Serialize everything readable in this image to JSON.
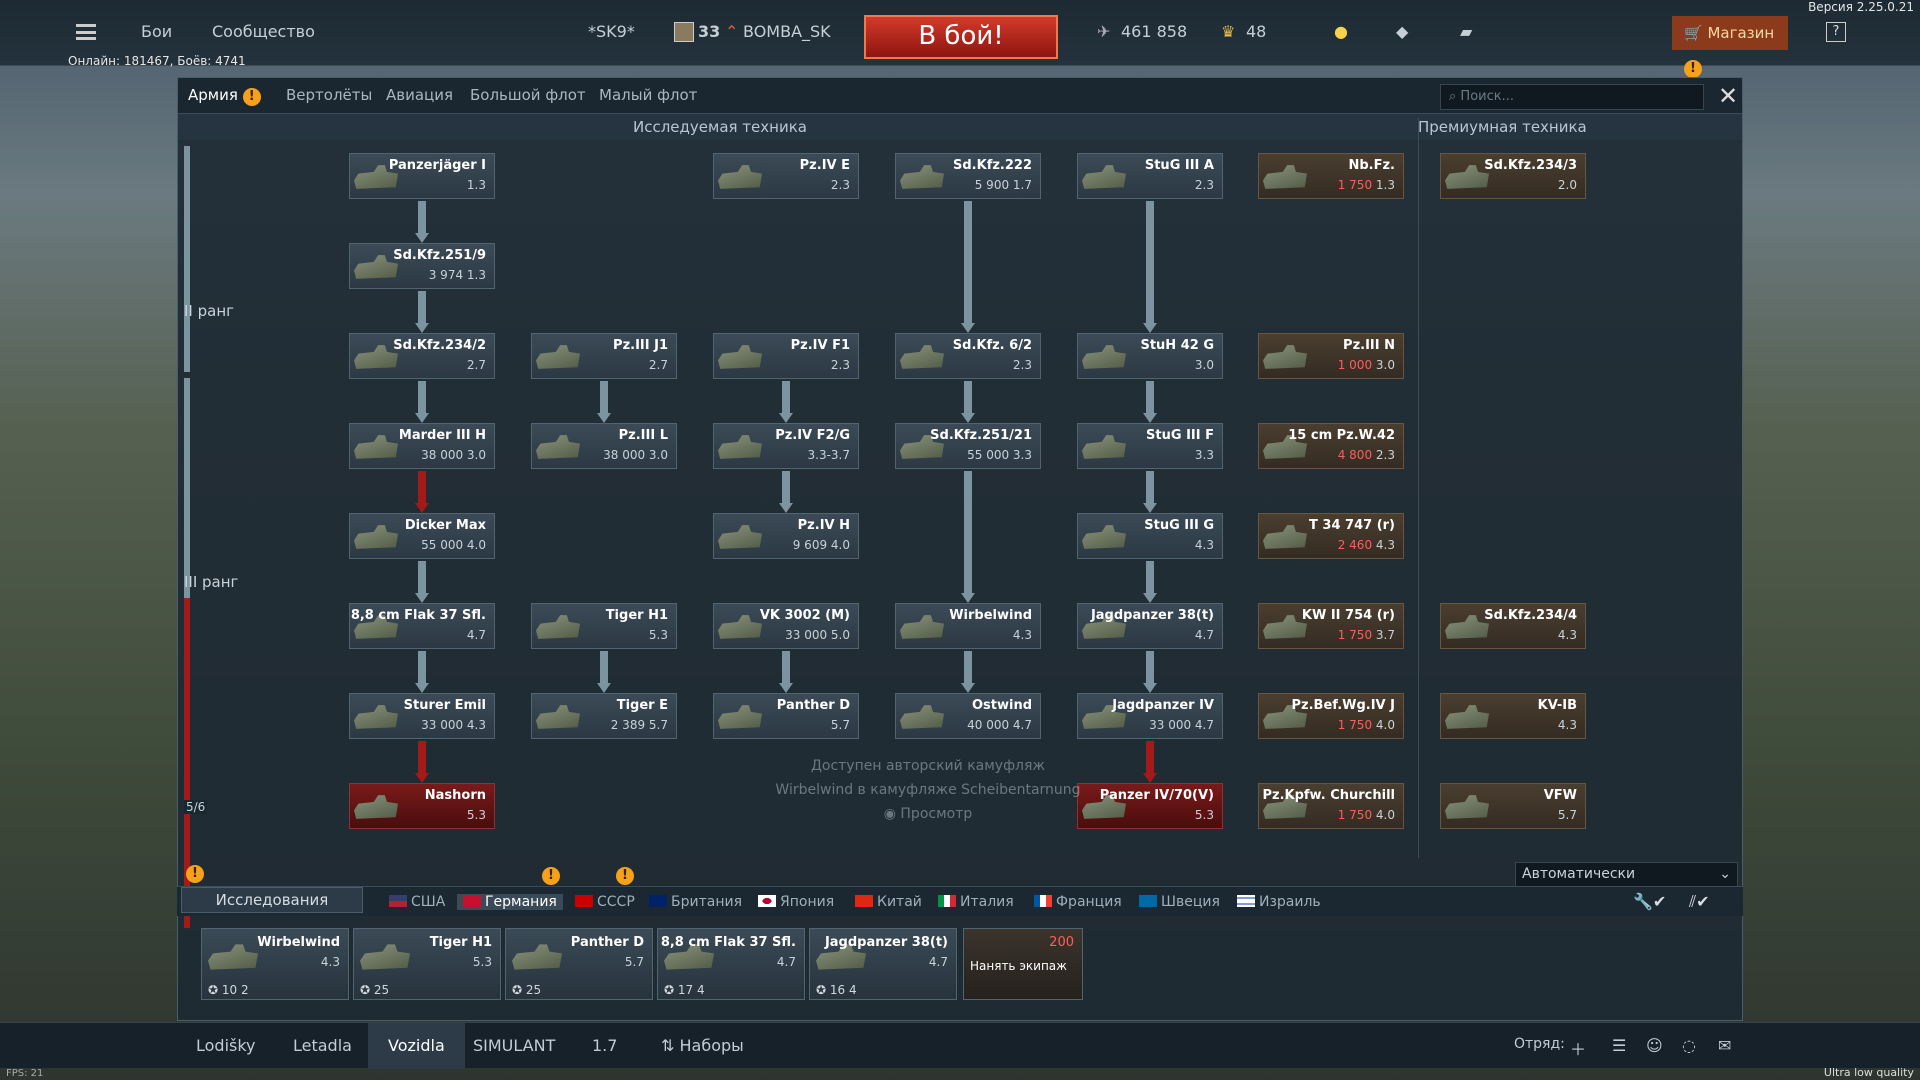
{
  "version": "Версия 2.25.0.21",
  "topbar": {
    "battles": "Бои",
    "community": "Сообщество",
    "squad_tag": "*SK9*",
    "level": "33",
    "nickname": "BOMBA_SK",
    "battle_button": "В бой!",
    "silver": "461 858",
    "gold": "48",
    "shop": "Магазин",
    "help": "?"
  },
  "online": "Онлайн: 181467, Боёв: 4741",
  "tabs": [
    "Армия",
    "Вертолёты",
    "Авиация",
    "Большой флот",
    "Малый флот"
  ],
  "search_placeholder": "Поиск...",
  "sections": {
    "researched": "Исследуемая техника",
    "premium": "Премиумная техника"
  },
  "ranks": {
    "r2": "II ранг",
    "r3": "III ранг",
    "progress": "5/6"
  },
  "tree": [
    {
      "name": "Panzerjäger I",
      "stat": "1.3"
    },
    {
      "name": "Sd.Kfz.251/9",
      "stat": "3 974  1.3"
    },
    {
      "name": "Pz.IV E",
      "stat": "2.3"
    },
    {
      "name": "Sd.Kfz.222",
      "stat": "5 900  1.7"
    },
    {
      "name": "StuG III A",
      "stat": "2.3"
    },
    {
      "name": "Sd.Kfz.234/2",
      "stat": "2.7"
    },
    {
      "name": "Pz.III J1",
      "stat": "2.7"
    },
    {
      "name": "Pz.IV F1",
      "stat": "2.3"
    },
    {
      "name": "Sd.Kfz. 6/2",
      "stat": "2.3"
    },
    {
      "name": "StuH 42 G",
      "stat": "3.0"
    },
    {
      "name": "Marder III H",
      "stat": "38 000  3.0"
    },
    {
      "name": "Pz.III L",
      "stat": "38 000  3.0"
    },
    {
      "name": "Pz.IV F2/G",
      "stat": "3.3-3.7"
    },
    {
      "name": "Sd.Kfz.251/21",
      "stat": "55 000  3.3"
    },
    {
      "name": "StuG III F",
      "stat": "3.3"
    },
    {
      "name": "Dicker Max",
      "stat": "55 000  4.0"
    },
    {
      "name": "Pz.IV H",
      "stat": "9 609  4.0"
    },
    {
      "name": "StuG III G",
      "stat": "4.3"
    },
    {
      "name": "8,8 cm Flak 37 Sfl.",
      "stat": "4.7"
    },
    {
      "name": "Tiger H1",
      "stat": "5.3"
    },
    {
      "name": "VK 3002 (M)",
      "stat": "33 000  5.0"
    },
    {
      "name": "Wirbelwind",
      "stat": "4.3"
    },
    {
      "name": "Jagdpanzer 38(t)",
      "stat": "4.7"
    },
    {
      "name": "Sturer Emil",
      "stat": "33 000  4.3"
    },
    {
      "name": "Tiger E",
      "stat": "2 389  5.7"
    },
    {
      "name": "Panther D",
      "stat": "5.7"
    },
    {
      "name": "Ostwind",
      "stat": "40 000  4.7"
    },
    {
      "name": "Jagdpanzer IV",
      "stat": "33 000  4.7"
    },
    {
      "name": "Nashorn",
      "stat": "5.3"
    },
    {
      "name": "Panzer IV/70(V)",
      "stat": "5.3"
    }
  ],
  "premium": [
    {
      "name": "Nb.Fz.",
      "cost": "1 750",
      "stat": "1.3"
    },
    {
      "name": "Sd.Kfz.234/3",
      "cost": "",
      "stat": "2.0"
    },
    {
      "name": "Pz.III N",
      "cost": "1 000",
      "stat": "3.0"
    },
    {
      "name": "15 cm Pz.W.42",
      "cost": "4 800",
      "stat": "2.3"
    },
    {
      "name": "T 34 747 (r)",
      "cost": "2 460",
      "stat": "4.3"
    },
    {
      "name": "KW II 754 (r)",
      "cost": "1 750",
      "stat": "3.7"
    },
    {
      "name": "Sd.Kfz.234/4",
      "cost": "",
      "stat": "4.3"
    },
    {
      "name": "Pz.Bef.Wg.IV J",
      "cost": "1 750",
      "stat": "4.0"
    },
    {
      "name": "KV-IB",
      "cost": "",
      "stat": "4.3"
    },
    {
      "name": "Pz.Kpfw. Churchill",
      "cost": "1 750",
      "stat": "4.0"
    },
    {
      "name": "VFW",
      "cost": "",
      "stat": "5.7"
    }
  ],
  "camo_notice": {
    "line1": "Доступен авторский камуфляж",
    "line2": "Wirbelwind в камуфляже Scheibentarnung",
    "preview": "Просмотр"
  },
  "crew_dropdown": "Автоматически",
  "research_label": "Исследования",
  "nations": [
    "США",
    "Германия",
    "СССР",
    "Британия",
    "Япония",
    "Китай",
    "Италия",
    "Франция",
    "Швеция",
    "Израиль"
  ],
  "slots": [
    {
      "name": "Wirbelwind",
      "br": "4.3",
      "count": "10",
      "extra": "2"
    },
    {
      "name": "Tiger H1",
      "br": "5.3",
      "count": "25",
      "extra": ""
    },
    {
      "name": "Panther D",
      "br": "5.7",
      "count": "25",
      "extra": ""
    },
    {
      "name": "8,8 cm Flak 37 Sfl.",
      "br": "4.7",
      "count": "17",
      "extra": "4"
    },
    {
      "name": "Jagdpanzer 38(t)",
      "br": "4.7",
      "count": "16",
      "extra": "4"
    }
  ],
  "hire_crew": {
    "cost": "200",
    "label": "Нанять экипаж"
  },
  "footer": {
    "tabs": [
      "Lodišky",
      "Letadla",
      "Vozidla",
      "SIMULANT",
      "1.7"
    ],
    "presets": "Наборы",
    "squad": "Отряд:"
  },
  "fps": "FPS: 21",
  "quality": "Ultra low quality"
}
